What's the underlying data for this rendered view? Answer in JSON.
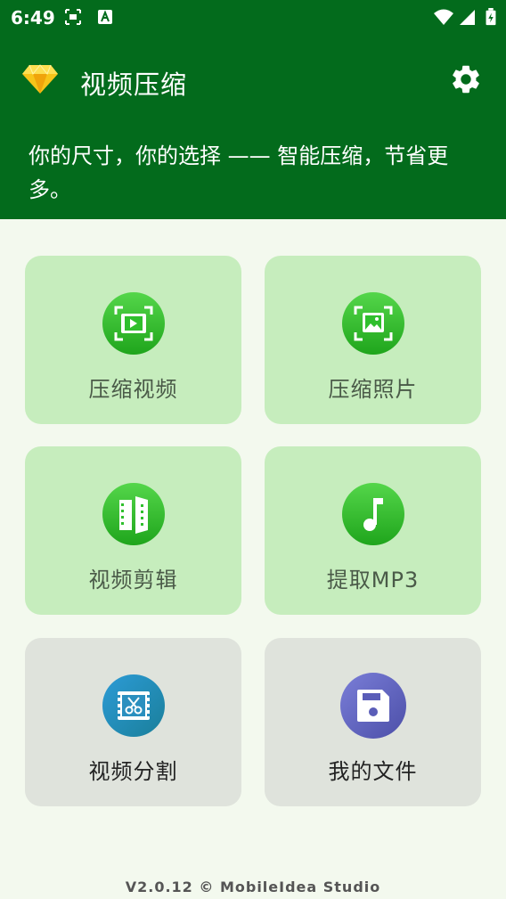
{
  "status_bar": {
    "time": "6:49"
  },
  "app_bar": {
    "title": "视频压缩"
  },
  "banner": {
    "text": "你的尺寸，你的选择 —— 智能压缩，节省更多。"
  },
  "tiles": [
    {
      "label": "压缩视频",
      "icon": "compress-video-icon"
    },
    {
      "label": "压缩照片",
      "icon": "compress-photo-icon"
    },
    {
      "label": "视频剪辑",
      "icon": "video-edit-icon"
    },
    {
      "label": "提取MP3",
      "icon": "music-note-icon"
    },
    {
      "label": "视频分割",
      "icon": "video-split-icon"
    },
    {
      "label": "我的文件",
      "icon": "save-icon"
    }
  ],
  "footer": {
    "text": "V2.0.12 © MobileIdea Studio"
  },
  "colors": {
    "header": "#036b1c",
    "tile_green": "#c6edbd",
    "tile_gray": "#dfe3dc",
    "accent_green": "#2fbf2d"
  }
}
